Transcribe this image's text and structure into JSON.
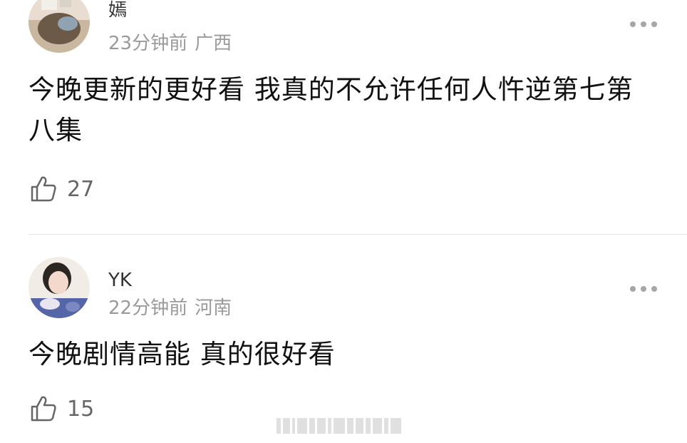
{
  "comments": [
    {
      "username": "嫣",
      "time": "23分钟前",
      "location": "广西",
      "text": "今晚更新的更好看 我真的不允许任何人忤逆第七第八集",
      "likes": "27"
    },
    {
      "username": "YK",
      "time": "22分钟前",
      "location": "河南",
      "text": "今晚剧情高能 真的很好看",
      "likes": "15"
    }
  ],
  "icons": {
    "like": "thumbs-up-icon",
    "more": "more-dots-icon"
  },
  "colors": {
    "meta_text": "#9a9a9a",
    "body_text": "#111111",
    "icon_gray": "#a6a6a6"
  }
}
